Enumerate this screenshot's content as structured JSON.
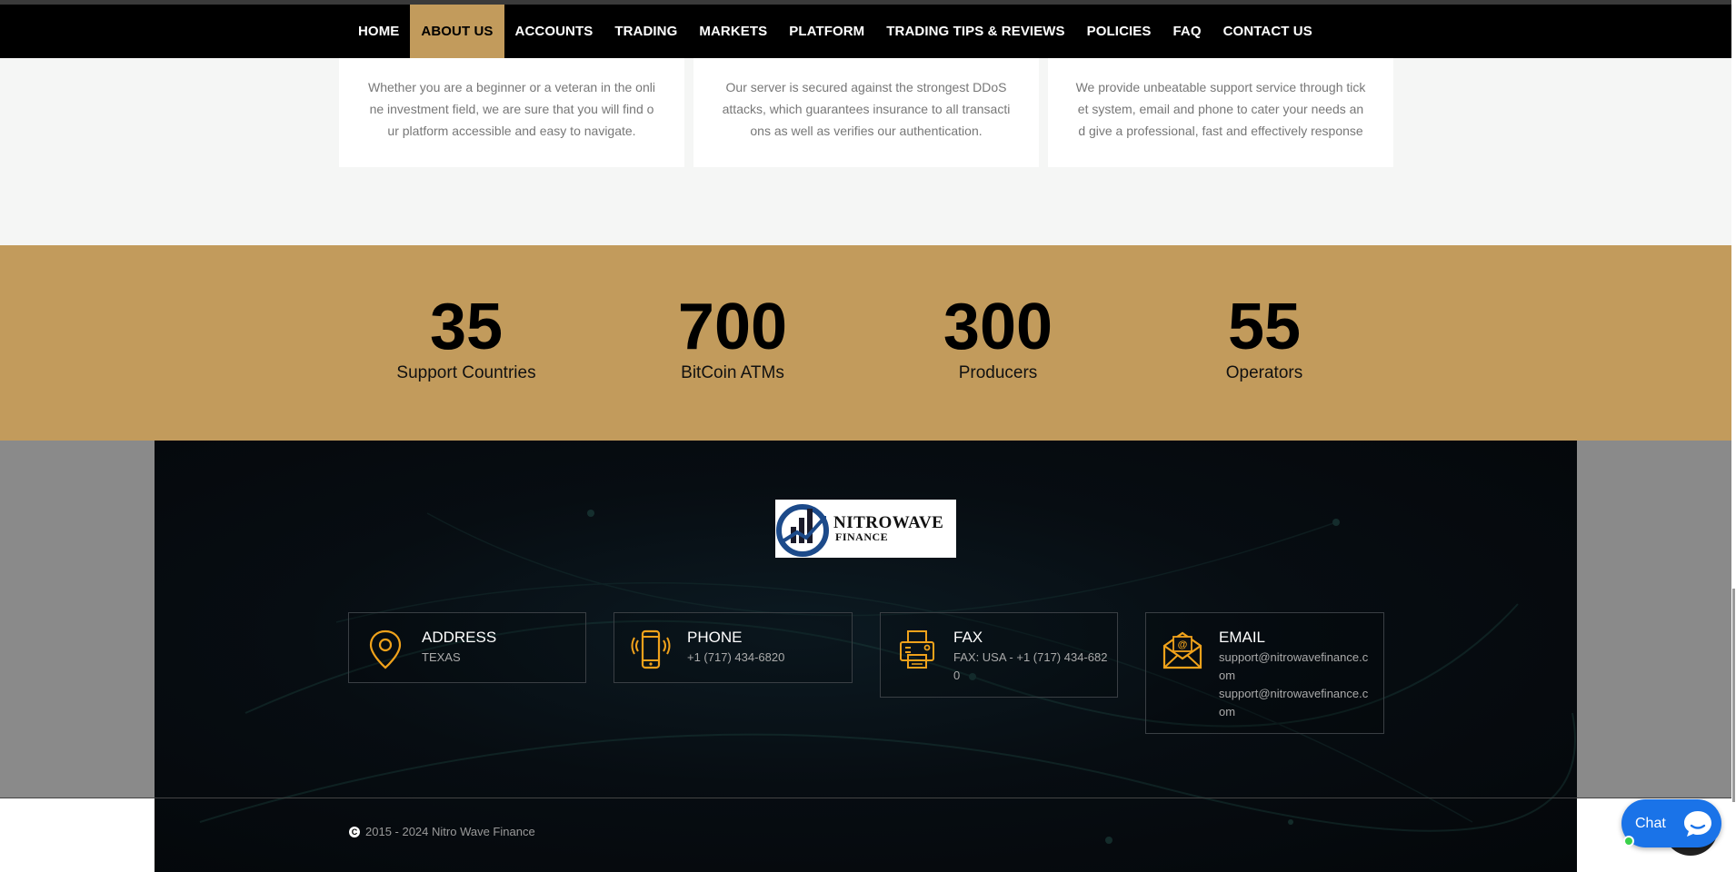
{
  "nav": {
    "items": [
      {
        "label": "HOME"
      },
      {
        "label": "ABOUT US"
      },
      {
        "label": "ACCOUNTS"
      },
      {
        "label": "TRADING"
      },
      {
        "label": "MARKETS"
      },
      {
        "label": "PLATFORM"
      },
      {
        "label": "TRADING TIPS & REVIEWS"
      },
      {
        "label": "POLICIES"
      },
      {
        "label": "FAQ"
      },
      {
        "label": "CONTACT US"
      }
    ],
    "active": "ABOUT US"
  },
  "features": [
    {
      "text": "Whether you are a beginner or a veteran in the online investment field, we are sure that you will find our platform accessible and easy to navigate."
    },
    {
      "text": "Our server is secured against the strongest DDoS attacks, which guarantees insurance to all transactions as well as verifies our authentication."
    },
    {
      "text": "We provide unbeatable support service through ticket system, email and phone to cater your needs and give a professional, fast and effectively response"
    }
  ],
  "stats": [
    {
      "number": "35",
      "label": "Support Countries"
    },
    {
      "number": "700",
      "label": "BitCoin ATMs"
    },
    {
      "number": "300",
      "label": "Producers"
    },
    {
      "number": "55",
      "label": "Operators"
    }
  ],
  "logo": {
    "line1": "NITROWAVE",
    "line2": "FINANCE"
  },
  "contacts": {
    "address": {
      "title": "ADDRESS",
      "value": "TEXAS",
      "icon": "location-pin-icon"
    },
    "phone": {
      "title": "PHONE",
      "value": "+1 (717) 434-6820",
      "icon": "mobile-phone-icon"
    },
    "fax": {
      "title": "FAX",
      "value": "FAX: USA - +1 (717) 434-6820",
      "icon": "fax-icon"
    },
    "email": {
      "title": "EMAIL",
      "value1": "support@nitrowavefinance.com",
      "value2": "support@nitrowavefinance.com",
      "icon": "envelope-icon"
    }
  },
  "copyright": {
    "text": "2015 - 2024 Nitro Wave Finance",
    "symbol": "C"
  },
  "chat": {
    "label": "Chat"
  },
  "colors": {
    "accent": "#c29b5c",
    "icon": "#f0a21b",
    "chat": "#1a73e8"
  }
}
